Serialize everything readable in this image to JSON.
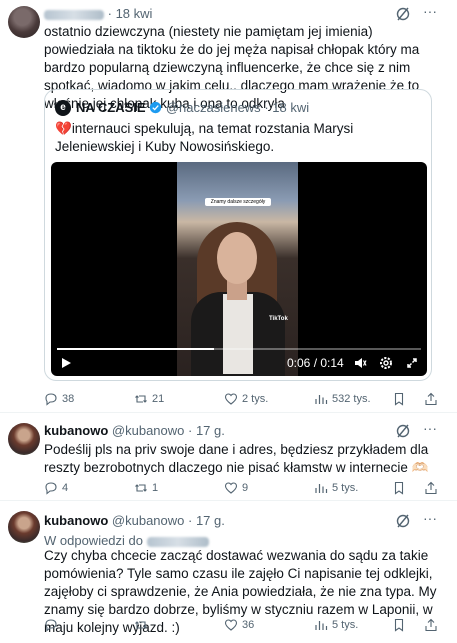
{
  "tweet1": {
    "time": "18 kwi",
    "text": "ostatnio dziewczyna (niestety nie pamiętam jej imienia) powiedziała na tiktoku że do jej męża napisał chłopak który ma bardzo popularną dziewczyną influencerke, że chce się z nim spotkać, wiadomo w jakim celu.. dlaczego mam wrażenie że to właśnie jej chłopak kuba i ona to odkryła",
    "quote": {
      "logo": "e",
      "name": "NA CZASIE",
      "handle": "@naczasienews",
      "time": "18 kwi",
      "emoji": "💔",
      "text": "internauci spekulują, na temat rozstania Marysi Jeleniewskiej i Kuby Nowosińskiego.",
      "video": {
        "current": "0:06",
        "total": "0:14",
        "progress": 0.43,
        "caption": "Znamy dalsze szczegóły",
        "watermark": "TikTok"
      }
    },
    "actions": {
      "replies": "38",
      "retweets": "21",
      "likes": "2 tys.",
      "views": "532 tys."
    }
  },
  "tweet2": {
    "name": "kubanowo",
    "handle": "@kubanowo",
    "time": "17 g.",
    "text": "Podeślij pls na priv swoje dane i adres, będziesz przykładem dla reszty bezrobotnych dlaczego nie pisać kłamstw w internecie 🫶🏻",
    "actions": {
      "replies": "4",
      "retweets": "1",
      "likes": "9",
      "views": "5 tys."
    }
  },
  "tweet3": {
    "name": "kubanowo",
    "handle": "@kubanowo",
    "time": "17 g.",
    "reply_prefix": "W odpowiedzi do",
    "text": "Czy chyba chcecie zacząć dostawać wezwania do sądu za takie pomówienia? Tyle samo czasu ile zajęło Ci napisanie tej odklejki, zajęłoby ci sprawdzenie, że Ania powiedziała, że nie zna typa. My znamy się bardzo dobrze, byliśmy w styczniu razem w Laponii, w maju kolejny wyjazd. :)",
    "actions": {
      "replies": "",
      "retweets": "",
      "likes": "36",
      "views": "5 tys."
    }
  },
  "colors": {
    "accent": "#1d9bf0",
    "muted": "#536471",
    "text": "#0f1419",
    "border": "#cfd9de"
  }
}
